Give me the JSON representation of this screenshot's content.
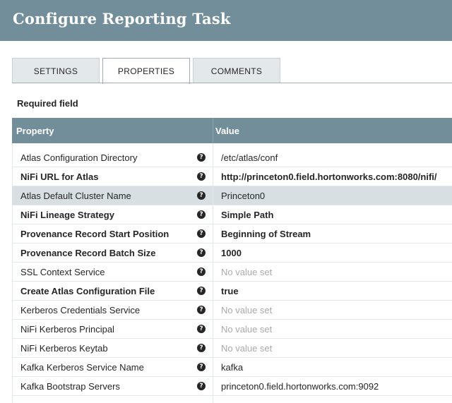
{
  "header": {
    "title": "Configure Reporting Task"
  },
  "tabs": [
    {
      "label": "SETTINGS"
    },
    {
      "label": "PROPERTIES"
    },
    {
      "label": "COMMENTS"
    }
  ],
  "required_note": "Required field",
  "table": {
    "columns": {
      "property": "Property",
      "value": "Value"
    },
    "rows": [
      {
        "name": "Atlas Configuration Directory",
        "value": "/etc/atlas/conf"
      },
      {
        "name": "NiFi URL for Atlas",
        "value": "http://princeton0.field.hortonworks.com:8080/nifi/"
      },
      {
        "name": "Atlas Default Cluster Name",
        "value": "Princeton0"
      },
      {
        "name": "NiFi Lineage Strategy",
        "value": "Simple Path"
      },
      {
        "name": "Provenance Record Start Position",
        "value": "Beginning of Stream"
      },
      {
        "name": "Provenance Record Batch Size",
        "value": "1000"
      },
      {
        "name": "SSL Context Service",
        "value": "No value set"
      },
      {
        "name": "Create Atlas Configuration File",
        "value": "true"
      },
      {
        "name": "Kerberos Credentials Service",
        "value": "No value set"
      },
      {
        "name": "NiFi Kerberos Principal",
        "value": "No value set"
      },
      {
        "name": "NiFi Kerberos Keytab",
        "value": "No value set"
      },
      {
        "name": "Kafka Kerberos Service Name",
        "value": "kafka"
      },
      {
        "name": "Kafka Bootstrap Servers",
        "value": "princeton0.field.hortonworks.com:9092"
      }
    ]
  },
  "help_icon": "question-circle-icon"
}
